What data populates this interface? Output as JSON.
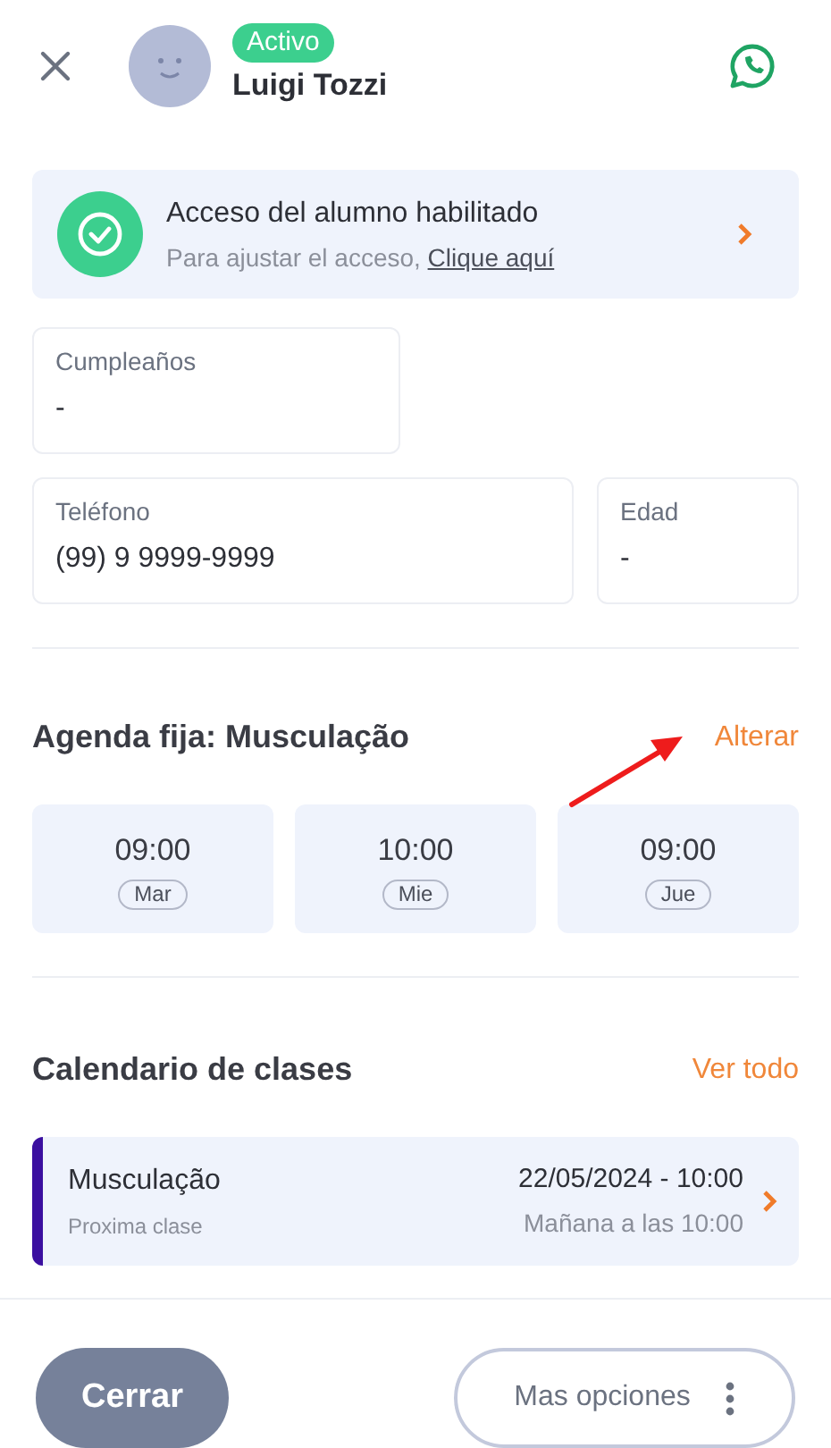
{
  "header": {
    "status": "Activo",
    "name": "Luigi Tozzi"
  },
  "access": {
    "title": "Acceso del alumno habilitado",
    "subtitle": "Para ajustar el acceso,",
    "link": "Clique aquí"
  },
  "fields": [
    {
      "label": "Cumpleaños",
      "value": "-"
    },
    {
      "label": "Teléfono",
      "value": "(99) 9 9999-9999"
    },
    {
      "label": "Edad",
      "value": "-"
    }
  ],
  "schedule": {
    "title": "Agenda fija: Musculação",
    "action": "Alterar",
    "slots": [
      {
        "time": "09:00",
        "day": "Mar"
      },
      {
        "time": "10:00",
        "day": "Mie"
      },
      {
        "time": "09:00",
        "day": "Jue"
      }
    ]
  },
  "calendar": {
    "title": "Calendario de clases",
    "action": "Ver todo",
    "classes": [
      {
        "name": "Musculação",
        "note": "Proxima clase",
        "date": "22/05/2024 - 10:00",
        "relative": "Mañana a las 10:00",
        "color": "#3b0fa0"
      }
    ]
  },
  "buttons": {
    "close": "Cerrar",
    "more": "Mas opciones"
  }
}
